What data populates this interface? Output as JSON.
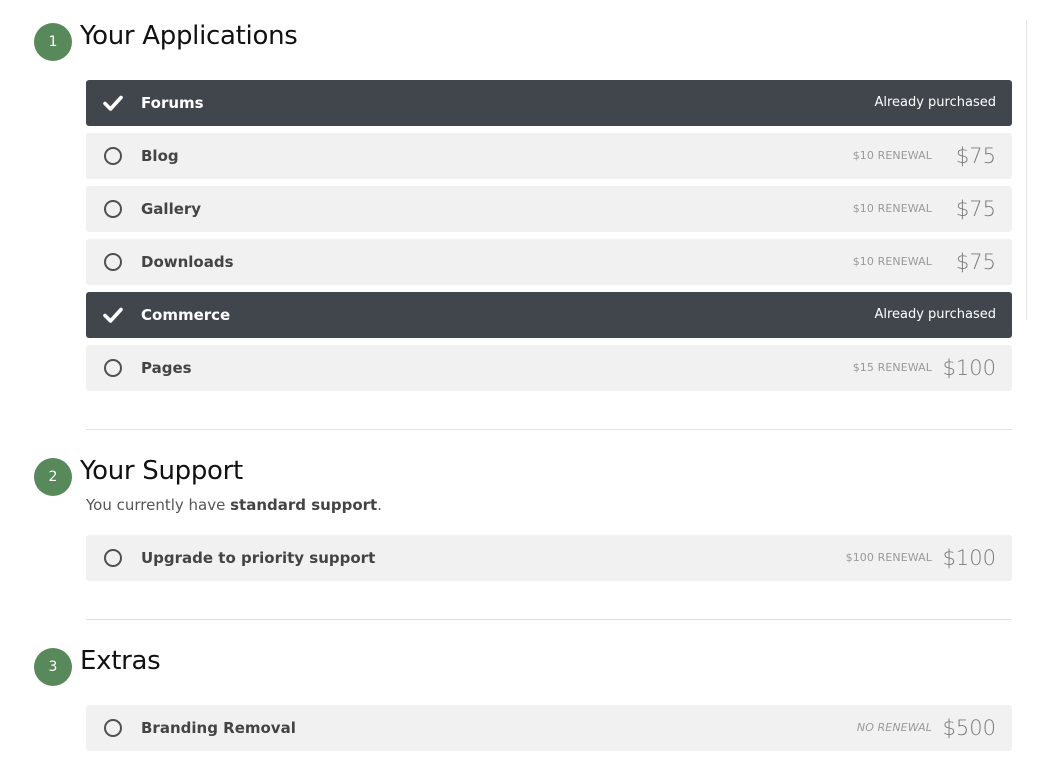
{
  "sections": [
    {
      "step": "1",
      "title": "Your Applications",
      "items": [
        {
          "name": "Forums",
          "status": "Already purchased"
        },
        {
          "name": "Blog",
          "renewal": "$10 RENEWAL",
          "price": "$75"
        },
        {
          "name": "Gallery",
          "renewal": "$10 RENEWAL",
          "price": "$75"
        },
        {
          "name": "Downloads",
          "renewal": "$10 RENEWAL",
          "price": "$75"
        },
        {
          "name": "Commerce",
          "status": "Already purchased"
        },
        {
          "name": "Pages",
          "renewal": "$15 RENEWAL",
          "price": "$100"
        }
      ]
    },
    {
      "step": "2",
      "title": "Your Support",
      "description_prefix": "You currently have ",
      "description_bold": "standard support",
      "description_suffix": ".",
      "items": [
        {
          "name": "Upgrade to priority support",
          "renewal": "$100 RENEWAL",
          "price": "$100"
        }
      ]
    },
    {
      "step": "3",
      "title": "Extras",
      "items": [
        {
          "name": "Branding Removal",
          "renewal": "NO RENEWAL",
          "price": "$500"
        }
      ]
    }
  ],
  "colors": {
    "badge": "#57895b",
    "purchased_row": "#41464d",
    "row": "#f1f1f1"
  },
  "icons": {
    "purchased": "checkmark-icon",
    "available": "radio-unchecked-icon"
  }
}
